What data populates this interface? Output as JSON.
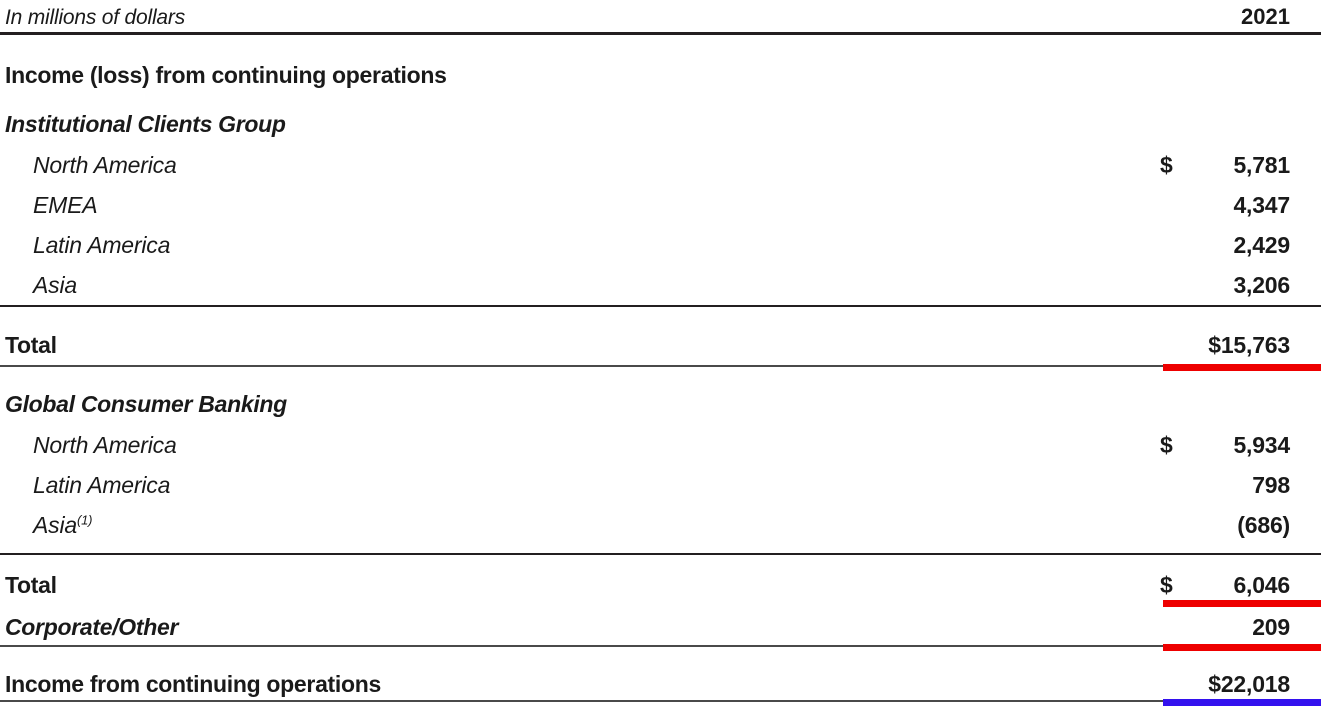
{
  "header": {
    "caption": "In millions of dollars",
    "year": "2021"
  },
  "section": {
    "title": "Income (loss) from continuing operations"
  },
  "groups": [
    {
      "name": "Institutional Clients Group",
      "rows": [
        {
          "label": "North America",
          "currency": "$",
          "value": "5,781"
        },
        {
          "label": "EMEA",
          "currency": "",
          "value": "4,347"
        },
        {
          "label": "Latin America",
          "currency": "",
          "value": "2,429"
        },
        {
          "label": "Asia",
          "currency": "",
          "value": "3,206"
        }
      ],
      "total": {
        "label": "Total",
        "currency": "",
        "value": "$15,763"
      }
    },
    {
      "name": "Global Consumer Banking",
      "rows": [
        {
          "label": "North America",
          "currency": "$",
          "value": "5,934"
        },
        {
          "label": "Latin America",
          "currency": "",
          "value": "798"
        },
        {
          "label": "Asia",
          "footnote": "(1)",
          "currency": "",
          "value": "(686)"
        }
      ],
      "total": {
        "label": "Total",
        "currency": "$",
        "value": "6,046"
      }
    }
  ],
  "corporate": {
    "label": "Corporate/Other",
    "currency": "",
    "value": "209"
  },
  "grand_total": {
    "label": "Income from continuing operations",
    "currency": "",
    "value": "$22,018"
  },
  "colors": {
    "accent_red": "#ee0000",
    "accent_blue": "#3311ee",
    "rule": "#231f20",
    "text": "#1a1a1a"
  }
}
